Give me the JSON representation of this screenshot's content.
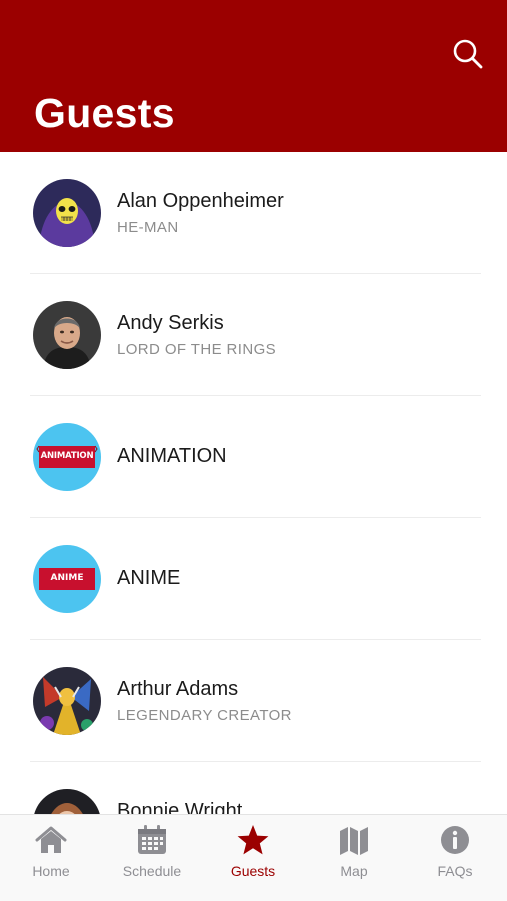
{
  "header": {
    "title": "Guests"
  },
  "guests": [
    {
      "name": "Alan Oppenheimer",
      "subtitle": "HE-MAN"
    },
    {
      "name": "Andy Serkis",
      "subtitle": "LORD OF THE RINGS"
    },
    {
      "label": "ANIMATION",
      "badge": "ANIMATION"
    },
    {
      "label": "ANIME",
      "badge": "ANIME"
    },
    {
      "name": "Arthur Adams",
      "subtitle": "LEGENDARY CREATOR"
    },
    {
      "name": "Bonnie Wright"
    }
  ],
  "tabbar": {
    "items": [
      {
        "label": "Home",
        "icon": "home-icon"
      },
      {
        "label": "Schedule",
        "icon": "calendar-icon"
      },
      {
        "label": "Guests",
        "icon": "star-icon",
        "active": true
      },
      {
        "label": "Map",
        "icon": "map-icon"
      },
      {
        "label": "FAQs",
        "icon": "info-icon"
      }
    ]
  },
  "colors": {
    "brand": "#9b0000",
    "inactive": "#8e8e93",
    "avatar_badge_bg": "#4cc4f0"
  }
}
